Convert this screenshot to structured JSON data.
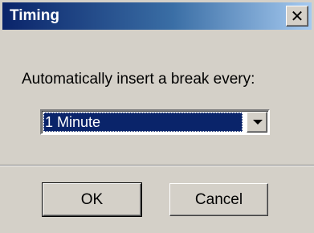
{
  "window": {
    "title": "Timing",
    "close_glyph": "✕"
  },
  "content": {
    "prompt": "Automatically insert a break every:",
    "interval_select": {
      "selected": "1 Minute",
      "arrow_icon": "chevron-down-icon"
    }
  },
  "buttons": {
    "ok_label": "OK",
    "cancel_label": "Cancel"
  },
  "colors": {
    "titlebar_start": "#0a246a",
    "titlebar_end": "#a6caf0",
    "face": "#d4d0c8",
    "selection": "#0a246a"
  }
}
